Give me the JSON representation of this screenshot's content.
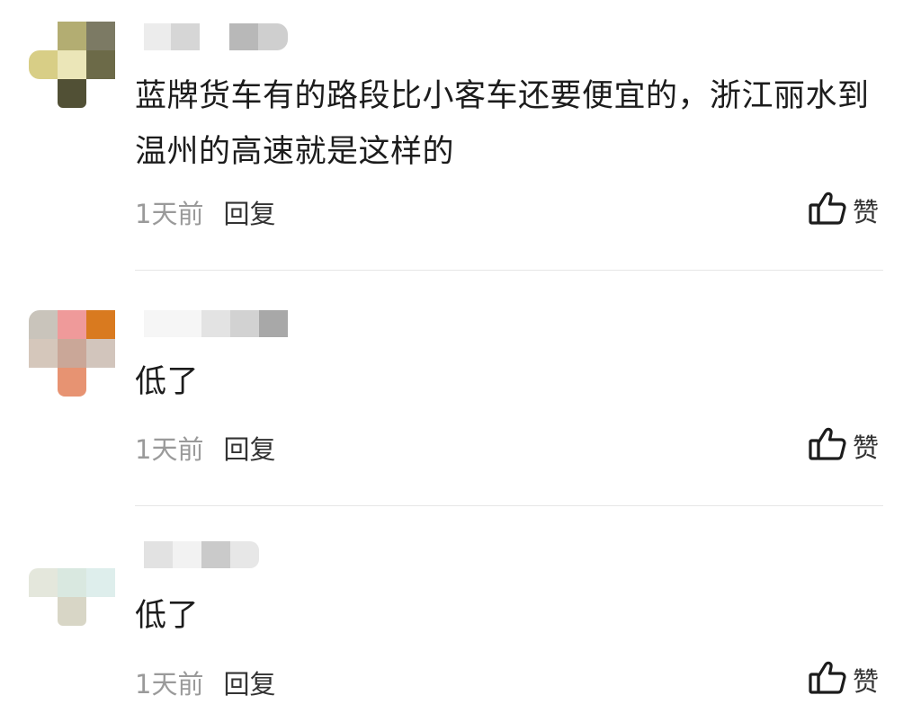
{
  "comments": [
    {
      "text": "蓝牌货车有的路段比小客车还要便宜的，浙江丽水到温州的高速就是这样的",
      "time": "1天前",
      "reply_label": "回复",
      "like_label": "赞"
    },
    {
      "text": "低了",
      "time": "1天前",
      "reply_label": "回复",
      "like_label": "赞"
    },
    {
      "text": "低了",
      "time": "1天前",
      "reply_label": "回复",
      "like_label": "赞"
    }
  ],
  "icons": {
    "like": "thumbs-up-icon"
  },
  "colors": {
    "text": "#1c1c1c",
    "muted": "#9a9a9a",
    "divider": "#e6e6e6"
  }
}
